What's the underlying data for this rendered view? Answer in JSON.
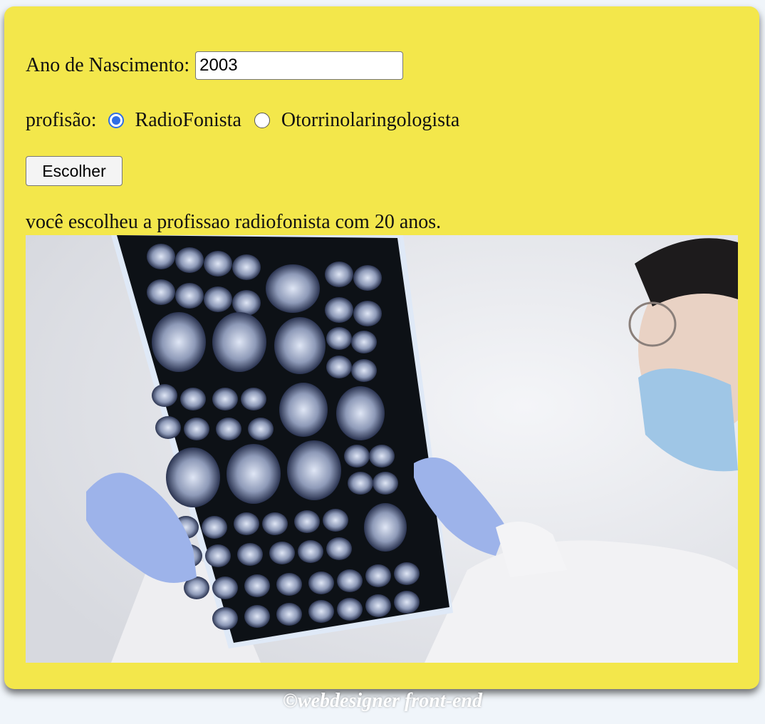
{
  "form": {
    "year_label": "Ano de Nascimento:",
    "year_value": "2003",
    "profession_label": "profisão:",
    "options": [
      {
        "label": "RadioFonista",
        "checked": true
      },
      {
        "label": "Otorrinolaringologista",
        "checked": false
      }
    ],
    "submit_label": "Escolher"
  },
  "result": {
    "text": "você escolheu a profissao radiofonista com 20 anos."
  },
  "photo": {
    "description_icon": "doctor-examining-brain-mri-photo"
  },
  "footer": {
    "text": "©webdesigner front-end"
  },
  "colors": {
    "card_background": "#f3e74b",
    "page_background": "#f0f5fa",
    "radio_accent": "#2f6de6"
  }
}
